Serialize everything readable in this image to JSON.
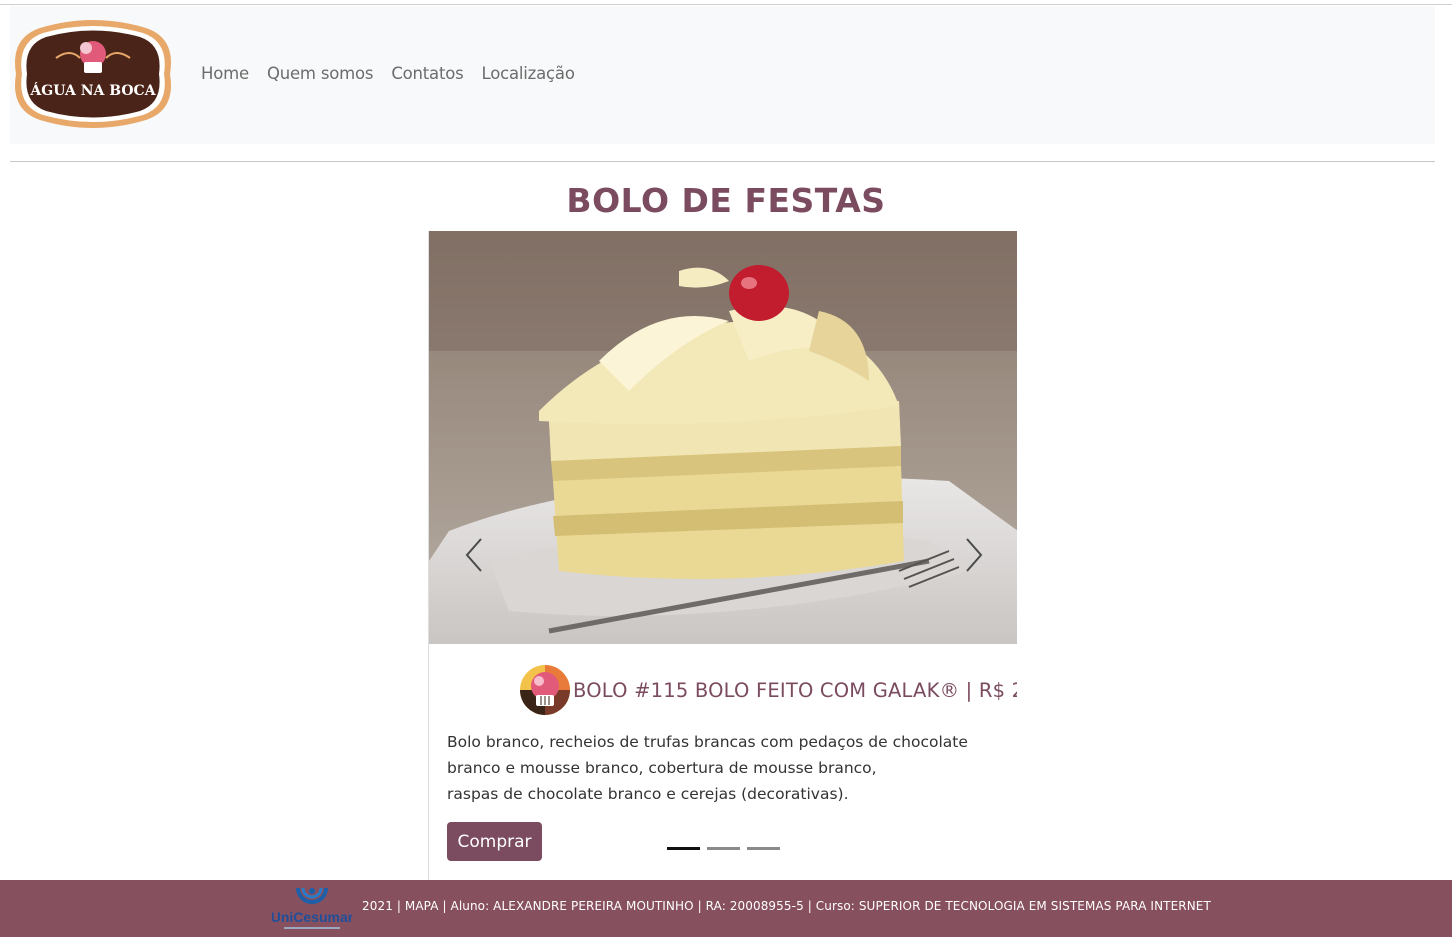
{
  "brand": {
    "logo_text": "ÁGUA NA BOCA"
  },
  "nav": {
    "items": [
      {
        "label": "Home"
      },
      {
        "label": "Quem somos"
      },
      {
        "label": "Contatos"
      },
      {
        "label": "Localização"
      }
    ]
  },
  "page": {
    "title": "BOLO DE FESTAS"
  },
  "carousel": {
    "active_index": 0,
    "slide_count": 3,
    "slide": {
      "title": "BOLO #115 BOLO FEITO COM GALAK® | R$ 2",
      "description_lines": [
        "Bolo branco, recheios de trufas brancas com pedaços de chocolate",
        "branco e mousse branco, cobertura de mousse branco,",
        "raspas de chocolate branco e cerejas (decorativas)."
      ],
      "button_label": "Comprar"
    },
    "prev_icon": "chevron-left-icon",
    "next_icon": "chevron-right-icon"
  },
  "footer": {
    "logo_text": "UniCesumar",
    "text": "2021 | MAPA | Aluno: ALEXANDRE PEREIRA MOUTINHO | RA: 20008955-5 | Curso: SUPERIOR DE TECNOLOGIA EM SISTEMAS PARA INTERNET"
  },
  "colors": {
    "accent": "#7b4b5f",
    "footer_bg": "#87505f",
    "navbar_bg": "#f8f9fa",
    "logo_dark": "#4a2418",
    "logo_border": "#e8a86a"
  }
}
